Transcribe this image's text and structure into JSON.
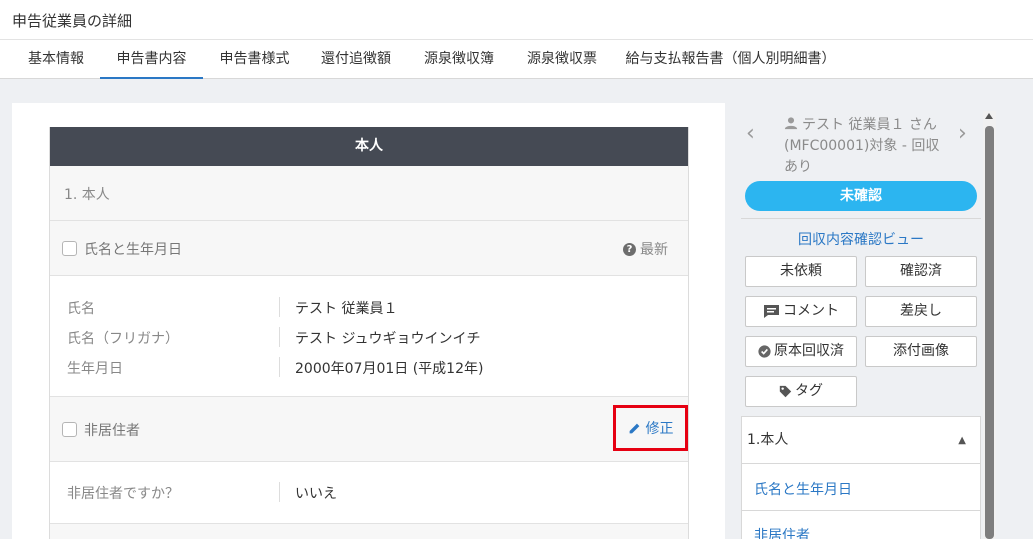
{
  "page": {
    "title": "申告従業員の詳細"
  },
  "tabs": [
    {
      "label": "基本情報"
    },
    {
      "label": "申告書内容"
    },
    {
      "label": "申告書様式"
    },
    {
      "label": "還付追徴額"
    },
    {
      "label": "源泉徴収簿"
    },
    {
      "label": "源泉徴収票"
    },
    {
      "label": "給与支払報告書（個人別明細書）"
    }
  ],
  "active_tab": "申告書内容",
  "card": {
    "header": "本人",
    "section_title": "1. 本人",
    "name_birth": {
      "checkbox_label": "氏名と生年月日",
      "latest_label": "最新",
      "fields": [
        {
          "label": "氏名",
          "value": "テスト 従業員１"
        },
        {
          "label": "氏名（フリガナ）",
          "value": "テスト ジュウギョウインイチ"
        },
        {
          "label": "生年月日",
          "value": "2000年07月01日 (平成12年)"
        }
      ]
    },
    "non_resident": {
      "checkbox_label": "非居住者",
      "edit_label": "修正",
      "fields": [
        {
          "label": "非居住者ですか？",
          "value": "いいえ"
        }
      ]
    }
  },
  "sidebar": {
    "employee_text": "テスト 従業員１ さん (MFC00001)対象 - 回収あり",
    "status_label": "未確認",
    "status_color": "#2cb5f0",
    "review_link": "回収内容確認ビュー",
    "buttons": {
      "not_requested": "未依頼",
      "confirmed": "確認済",
      "comment": "コメント",
      "send_back": "差戻し",
      "original_collected": "原本回収済",
      "attached_image": "添付画像",
      "tag": "タグ"
    },
    "accordion": {
      "header": "1.本人",
      "items": [
        "氏名と生年月日",
        "非居住者"
      ]
    }
  },
  "colors": {
    "accent": "#2b78c5",
    "header_bg": "#454a54",
    "highlight_border": "#e60012"
  }
}
